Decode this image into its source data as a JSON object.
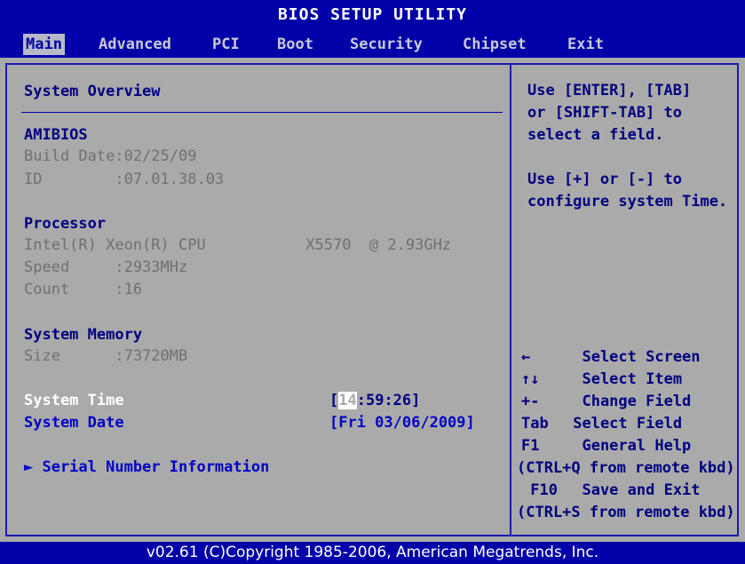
{
  "title": "BIOS SETUP UTILITY",
  "tabs": [
    {
      "label": "Main",
      "active": true
    },
    {
      "label": "Advanced"
    },
    {
      "label": "PCI"
    },
    {
      "label": "Boot"
    },
    {
      "label": "Security"
    },
    {
      "label": "Chipset"
    },
    {
      "label": "Exit"
    }
  ],
  "main": {
    "section_title": "System Overview",
    "amibios": {
      "heading": "AMIBIOS",
      "build_date": "Build Date:02/25/09",
      "id": "ID        :07.01.38.03"
    },
    "processor": {
      "heading": "Processor",
      "cpu": "Intel(R) Xeon(R) CPU           X5570  @ 2.93GHz",
      "speed": "Speed     :2933MHz",
      "count": "Count     :16"
    },
    "memory": {
      "heading": "System Memory",
      "size": "Size      :73720MB"
    },
    "system_time": {
      "label": "System Time",
      "value_open": "[",
      "value_hl": "14",
      "value_rest": ":59:26]"
    },
    "system_date": {
      "label": "System Date",
      "value": "[Fri 03/06/2009]"
    },
    "serial_number": "► Serial Number Information"
  },
  "help": {
    "lines": [
      "Use [ENTER], [TAB]",
      "or [SHIFT-TAB] to",
      "select a field.",
      "",
      "Use [+] or [-] to",
      "configure system Time."
    ],
    "nav": [
      {
        "key": "←",
        "desc": "  Select Screen"
      },
      {
        "key": "↑↓",
        "desc": "  Select Item"
      },
      {
        "key": "+-",
        "desc": "  Change Field"
      },
      {
        "key": "Tab",
        "desc": " Select Field"
      },
      {
        "key": "F1",
        "desc": "  General Help"
      },
      {
        "key": "(CTRL+Q from remote kbd)",
        "desc": ""
      },
      {
        "key": " F10",
        "desc": "  Save and Exit"
      },
      {
        "key": "(CTRL+S from remote kbd)",
        "desc": ""
      }
    ]
  },
  "footer": "v02.61 (C)Copyright 1985-2006, American Megatrends, Inc.",
  "colors": {
    "background": "#0000a8",
    "panel": "#aaaaaa",
    "text_navy": "#000080",
    "text_grey": "#707070",
    "text_white": "#ffffff",
    "highlight": "#ffffff"
  }
}
